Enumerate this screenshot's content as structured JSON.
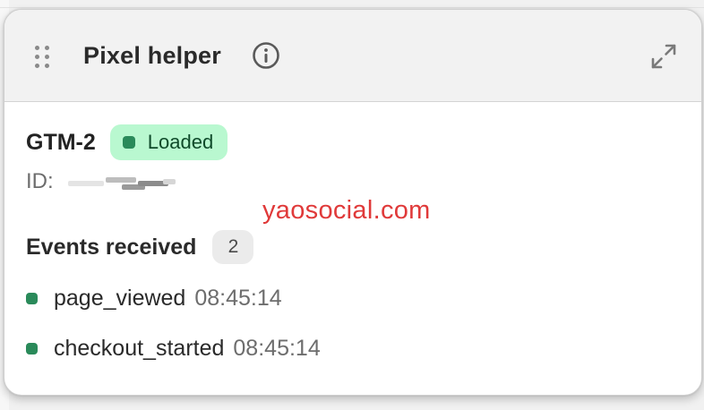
{
  "header": {
    "title": "Pixel helper",
    "drag_icon": "drag-handle-icon",
    "info_icon": "info-icon",
    "expand_icon": "expand-icon"
  },
  "tag": {
    "name": "GTM-2",
    "status": "Loaded",
    "id_label": "ID:"
  },
  "watermark": "yaosocial.com",
  "events": {
    "title": "Events received",
    "count": "2",
    "items": [
      {
        "name": "page_viewed",
        "time": "08:45:14"
      },
      {
        "name": "checkout_started",
        "time": "08:45:14"
      }
    ]
  },
  "colors": {
    "status_green": "#2a8a5a",
    "status_badge_bg": "#b9f8d0",
    "watermark_red": "#e03a3a"
  }
}
